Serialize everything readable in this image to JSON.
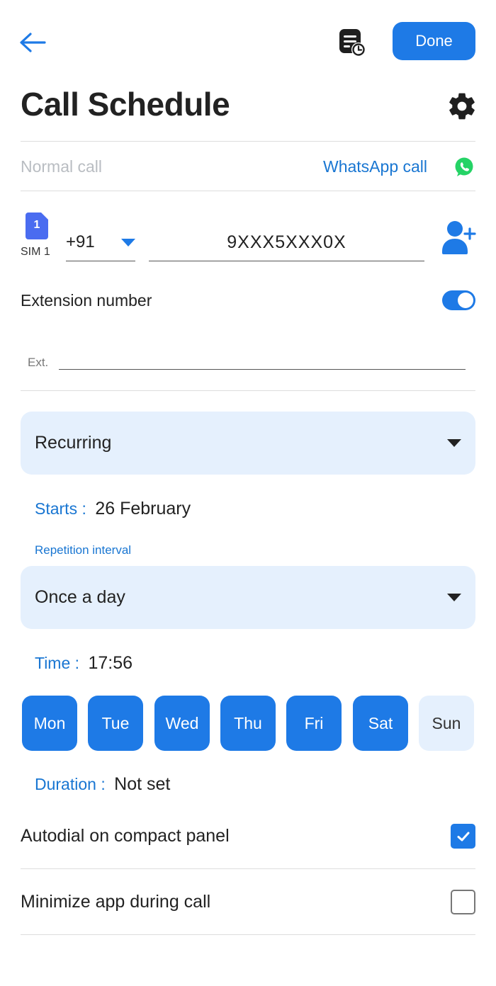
{
  "header": {
    "title": "Call Schedule",
    "done_label": "Done"
  },
  "call_type": {
    "normal_label": "Normal call",
    "whatsapp_label": "WhatsApp call"
  },
  "phone": {
    "sim_number": "1",
    "sim_label": "SIM 1",
    "country_code": "+91",
    "number": "9XXX5XXX0X"
  },
  "extension": {
    "label": "Extension number",
    "enabled": true,
    "field_prefix": "Ext."
  },
  "schedule": {
    "mode": "Recurring",
    "starts_label": "Starts :",
    "starts_value": "26 February",
    "repetition_label": "Repetition interval",
    "repetition_value": "Once a day",
    "time_label": "Time :",
    "time_value": "17:56",
    "days": [
      {
        "label": "Mon",
        "selected": true
      },
      {
        "label": "Tue",
        "selected": true
      },
      {
        "label": "Wed",
        "selected": true
      },
      {
        "label": "Thu",
        "selected": true
      },
      {
        "label": "Fri",
        "selected": true
      },
      {
        "label": "Sat",
        "selected": true
      },
      {
        "label": "Sun",
        "selected": false
      }
    ],
    "duration_label": "Duration :",
    "duration_value": "Not set"
  },
  "options": {
    "autodial_label": "Autodial on compact panel",
    "autodial_checked": true,
    "minimize_label": "Minimize app during call",
    "minimize_checked": false
  },
  "icons": {
    "back": "arrow-left-icon",
    "history": "schedule-history-icon",
    "settings": "gear-icon",
    "whatsapp": "whatsapp-icon",
    "sim": "sim-card-icon",
    "contact": "add-contact-icon",
    "check": "checkmark-icon"
  },
  "colors": {
    "accent": "#1e7ae6",
    "accent_light": "#e5f0fd",
    "whatsapp": "#25d366"
  }
}
